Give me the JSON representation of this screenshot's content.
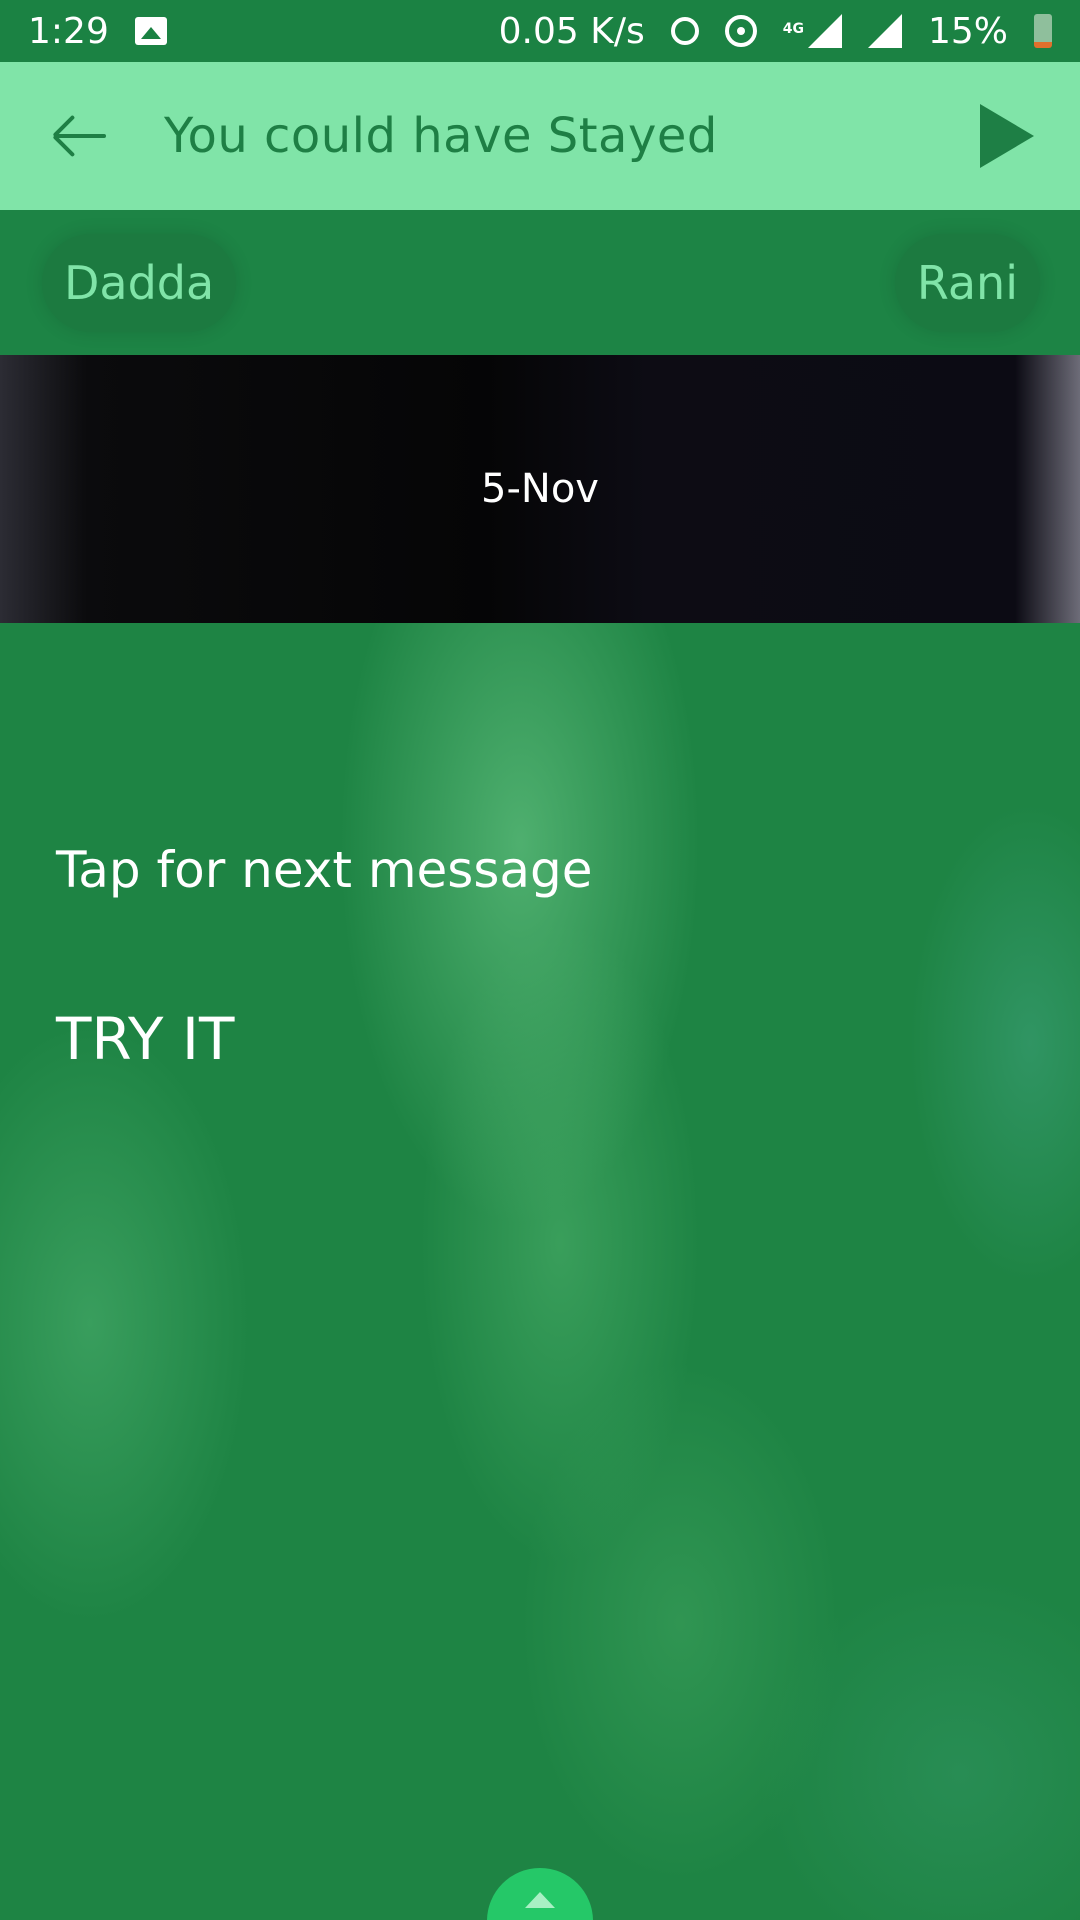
{
  "status_bar": {
    "time": "1:29",
    "net_speed": "0.05 K/s",
    "network_type": "4G",
    "battery": "15%",
    "icons": [
      "image-icon",
      "alarm-icon",
      "hotspot-icon",
      "signal-icon",
      "battery-icon"
    ]
  },
  "app_bar": {
    "title": "You could have Stayed",
    "icons": [
      "back-arrow-icon",
      "play-icon"
    ]
  },
  "participants": {
    "left": "Dadda",
    "right": "Rani"
  },
  "date_banner": {
    "date": "5-Nov"
  },
  "messages": {
    "tap_hint": "Tap for next message",
    "try_it": "TRY IT"
  },
  "colors": {
    "app_bar": "#80e4a8",
    "primary_dark": "#1b8243",
    "accent": "#25c868"
  }
}
